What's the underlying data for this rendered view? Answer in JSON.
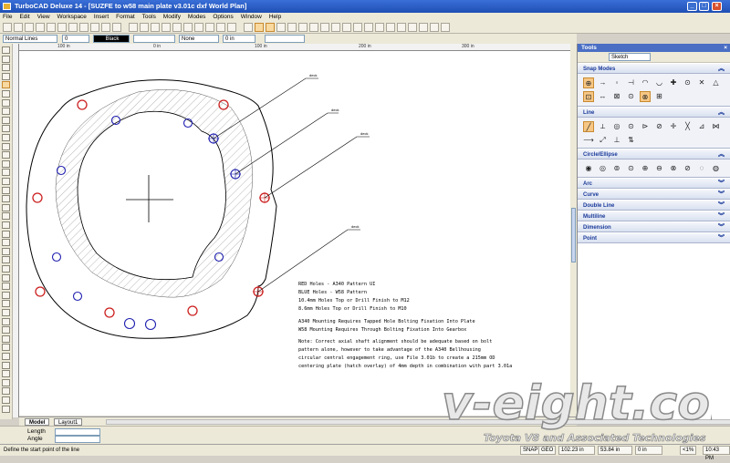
{
  "window": {
    "title": "TurboCAD Deluxe 14 - [SUZFE to w58 main plate v3.01c dxf World Plan]"
  },
  "menu": [
    "File",
    "Edit",
    "View",
    "Workspace",
    "Insert",
    "Format",
    "Tools",
    "Modify",
    "Modes",
    "Options",
    "Window",
    "Help"
  ],
  "props": {
    "line_style": "Normal Lines",
    "width": "0",
    "color": "Black",
    "pattern": "None",
    "value_a": "0",
    "value_b": "0 in"
  },
  "ruler": {
    "h": [
      "100 in",
      "0 in",
      "100 in",
      "200 in",
      "300 in"
    ],
    "v": [
      "100 in",
      "0 in"
    ]
  },
  "drawing": {
    "callouts": [
      "deck",
      "deck",
      "deck",
      "deck"
    ],
    "notes": [
      "RED Holes - A340 Pattern UI",
      "BLUE Holes - W58 Pattern",
      "10.4mm Holes Top or Drill Finish to M12",
      "8.6mm Holes Top or Drill Finish to M10",
      "",
      "A340 Mounting Requires Tapped Hole Bolting Fixation Into Plate",
      "W58 Mounting Requires Through Bolting Fixation Into Gearbox",
      "",
      "Note: Correct axial shaft alignment should be adequate based on bolt",
      "       pattern alone, however to take advantage of the A340 Bellhousing",
      "       circular central engagement ring, use File 3.01b to create a 215mm OD",
      "       centering plate (hatch overlay) of 4mm depth in combination with part 3.01a"
    ],
    "red_color": "#cc2020",
    "blue_color": "#2020b0"
  },
  "tabs": {
    "model": "Model",
    "layout": "Layout1"
  },
  "inspector": {
    "length": "Length",
    "angle": "Angle"
  },
  "status": {
    "prompt": "Define the start point of the line",
    "snap": "SNAP",
    "geo": "GEO",
    "x": "102.23 in",
    "y": "53.84 in",
    "z": "0 in",
    "zoom": "<1%",
    "time": "10:43 PM"
  },
  "panel": {
    "title": "Tools",
    "mode": "Sketch",
    "sections": [
      "Snap Modes",
      "Line",
      "Circle/Ellipse",
      "Arc",
      "Curve",
      "Double Line",
      "Multiline",
      "Dimension",
      "Point"
    ]
  },
  "watermark": {
    "brand": "v-eight.com",
    "tagline": "Toyota V8 and Associated Technologies"
  }
}
